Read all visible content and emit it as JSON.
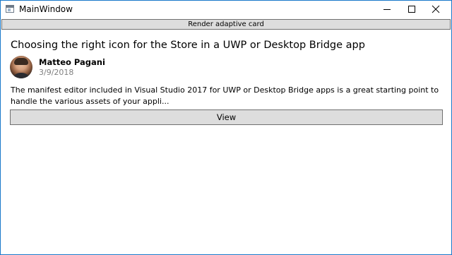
{
  "window": {
    "title": "MainWindow",
    "icon": "app-window-icon",
    "controls": {
      "minimize_icon": "minimize-icon",
      "maximize_icon": "maximize-icon",
      "close_icon": "close-icon"
    }
  },
  "toolbar": {
    "render_button_label": "Render adaptive card"
  },
  "card": {
    "title": "Choosing the right icon for the Store in a UWP or Desktop Bridge app",
    "author": "Matteo Pagani",
    "date": "3/9/2018",
    "avatar": "author-avatar",
    "description": "The manifest editor included in Visual Studio 2017 for UWP or Desktop Bridge apps is a great starting point to handle the various assets of your appli...",
    "view_button_label": "View"
  },
  "colors": {
    "window_border": "#1979ca",
    "button_face": "#dddddd",
    "button_border": "#707070",
    "date_text": "#808080"
  }
}
